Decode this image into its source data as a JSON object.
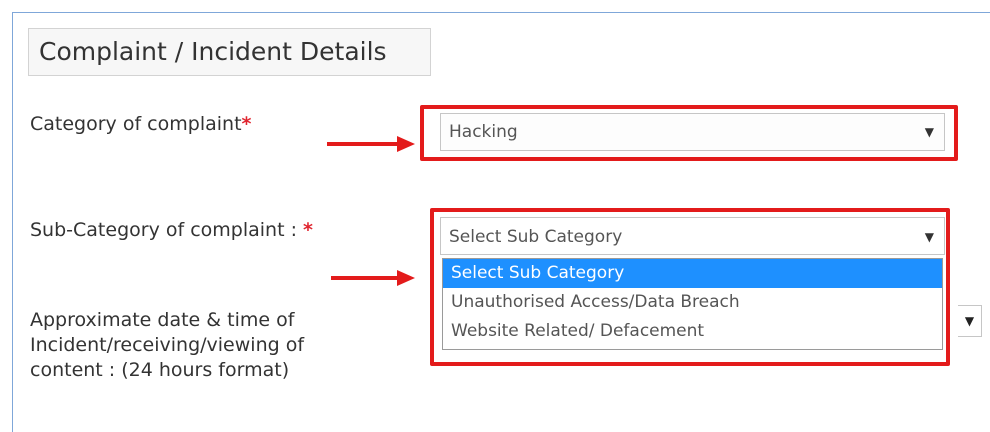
{
  "section": {
    "title": "Complaint / Incident Details"
  },
  "fields": {
    "category": {
      "label": "Category of complaint",
      "required_mark": "*",
      "value": "Hacking"
    },
    "subcategory": {
      "label": "Sub-Category of complaint : ",
      "required_mark": "*",
      "value": "Select Sub Category",
      "options": [
        "Select Sub Category",
        "Unauthorised Access/Data Breach",
        "Website Related/ Defacement"
      ]
    },
    "incident_date": {
      "label_lines": [
        "Approximate date & time of",
        "Incident/receiving/viewing of",
        "content : (24 hours format)"
      ]
    }
  },
  "icons": {
    "dropdown": "chevron-down-icon",
    "annotation": "red-arrow-icon"
  },
  "colors": {
    "highlight": "#e31b1b",
    "selected_option": "#1e90ff",
    "required": "#e0252f"
  }
}
